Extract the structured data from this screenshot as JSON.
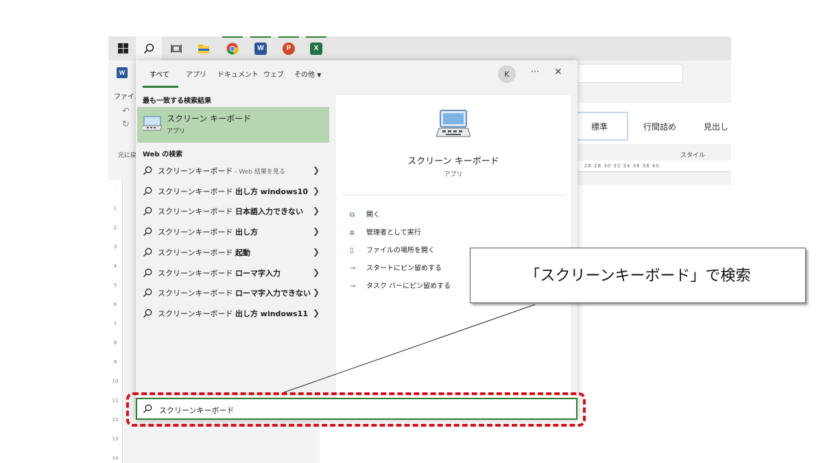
{
  "taskbar": {
    "items": [
      {
        "name": "windows-start-icon"
      },
      {
        "name": "search-icon"
      },
      {
        "name": "task-view-icon"
      },
      {
        "name": "file-explorer-icon"
      },
      {
        "name": "chrome-icon"
      },
      {
        "name": "word-icon",
        "letter": "W",
        "color": "#2b579a"
      },
      {
        "name": "powerpoint-icon",
        "letter": "P",
        "color": "#d24726"
      },
      {
        "name": "excel-icon",
        "letter": "X",
        "color": "#217346"
      }
    ]
  },
  "word": {
    "file_label": "ファイル",
    "undo_label": "元に戻",
    "ruler_numbers": "26 28 30 32 34 36 38 40",
    "styles": [
      "標準",
      "行間詰め",
      "見出し"
    ],
    "style_group_label": "スタイル"
  },
  "search_panel": {
    "tabs": [
      "すべて",
      "アプリ",
      "ドキュメント",
      "ウェブ",
      "その他"
    ],
    "active_tab": "すべて",
    "avatar_initial": "K",
    "best_match_title": "最も一致する検索結果",
    "best_match": {
      "name": "スクリーン キーボード",
      "type": "アプリ"
    },
    "web_title": "Web の検索",
    "web_results": [
      {
        "prefix": "スクリーンキーボード",
        "bold": "",
        "suffix": " - Web 結果を見る"
      },
      {
        "prefix": "スクリーンキーボード ",
        "bold": "出し方 windows10",
        "suffix": ""
      },
      {
        "prefix": "スクリーンキーボード ",
        "bold": "日本語入力できない",
        "suffix": ""
      },
      {
        "prefix": "スクリーンキーボード ",
        "bold": "出し方",
        "suffix": ""
      },
      {
        "prefix": "スクリーンキーボード ",
        "bold": "起動",
        "suffix": ""
      },
      {
        "prefix": "スクリーンキーボード ",
        "bold": "ローマ字入力",
        "suffix": ""
      },
      {
        "prefix": "スクリーンキーボード ",
        "bold": "ローマ字入力できない",
        "suffix": ""
      },
      {
        "prefix": "スクリーンキーボード ",
        "bold": "出し方 windows11",
        "suffix": ""
      }
    ],
    "detail": {
      "name": "スクリーン キーボード",
      "type": "アプリ",
      "actions": [
        {
          "icon": "open-icon",
          "label": "開く"
        },
        {
          "icon": "run-as-admin-icon",
          "label": "管理者として実行"
        },
        {
          "icon": "folder-location-icon",
          "label": "ファイルの場所を開く"
        },
        {
          "icon": "pin-start-icon",
          "label": "スタートにピン留めする"
        },
        {
          "icon": "pin-taskbar-icon",
          "label": "タスク バーにピン留めする"
        }
      ]
    },
    "search_value": "スクリーンキーボード"
  },
  "callout": {
    "text": "「スクリーンキーボード」で検索"
  },
  "colors": {
    "accent_green": "#2e7d32",
    "highlight_red": "#d0121b",
    "best_match_bg": "#b5d6b0"
  }
}
